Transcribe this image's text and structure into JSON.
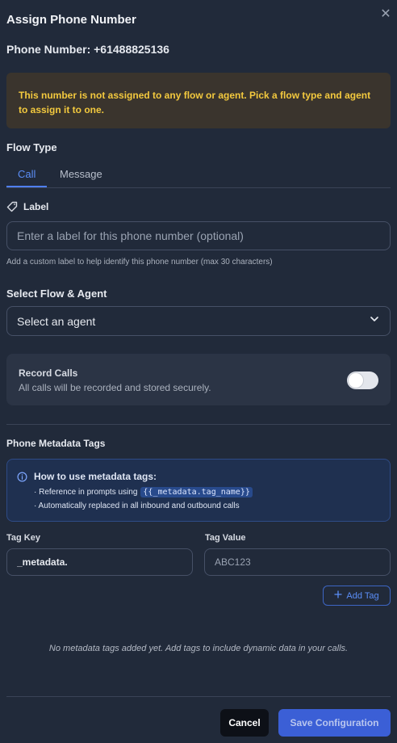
{
  "dialog": {
    "title": "Assign Phone Number",
    "close_glyph": "✕",
    "phone_number_line": "Phone Number: +61488825136"
  },
  "warning": {
    "text": "This number is not assigned to any flow or agent. Pick a flow type and agent to assign it to one.",
    "color": "#f3c93e"
  },
  "flow_type": {
    "title": "Flow Type",
    "tabs": [
      {
        "label": "Call",
        "active": true
      },
      {
        "label": "Message",
        "active": false
      }
    ]
  },
  "label_field": {
    "title": "Label",
    "icon": "tag-icon",
    "placeholder": "Enter a label for this phone number (optional)",
    "value": "",
    "helper": "Add a custom label to help identify this phone number (max 30 characters)"
  },
  "flow_agent": {
    "title": "Select Flow & Agent",
    "selected": "Select an agent",
    "icon": "chevron-down-icon"
  },
  "record_calls": {
    "title": "Record Calls",
    "description": "All calls will be recorded and stored securely.",
    "enabled": false
  },
  "metadata": {
    "title": "Phone Metadata Tags",
    "info": {
      "icon": "info-icon",
      "heading": "How to use metadata tags:",
      "line1_prefix": "· Reference in prompts using",
      "line1_code": "{{_metadata.tag_name}}",
      "line2": "· Automatically replaced in all inbound and outbound calls"
    },
    "tag_key": {
      "label": "Tag Key",
      "value": "_metadata."
    },
    "tag_value": {
      "label": "Tag Value",
      "placeholder": "ABC123",
      "value": ""
    },
    "add_button": {
      "label": "Add Tag",
      "icon": "plus-icon"
    },
    "empty_text": "No metadata tags added yet. Add tags to include dynamic data in your calls."
  },
  "footer": {
    "cancel_label": "Cancel",
    "save_label": "Save Configuration"
  },
  "colors": {
    "accent": "#4f7ff5",
    "background": "#212a3a"
  }
}
